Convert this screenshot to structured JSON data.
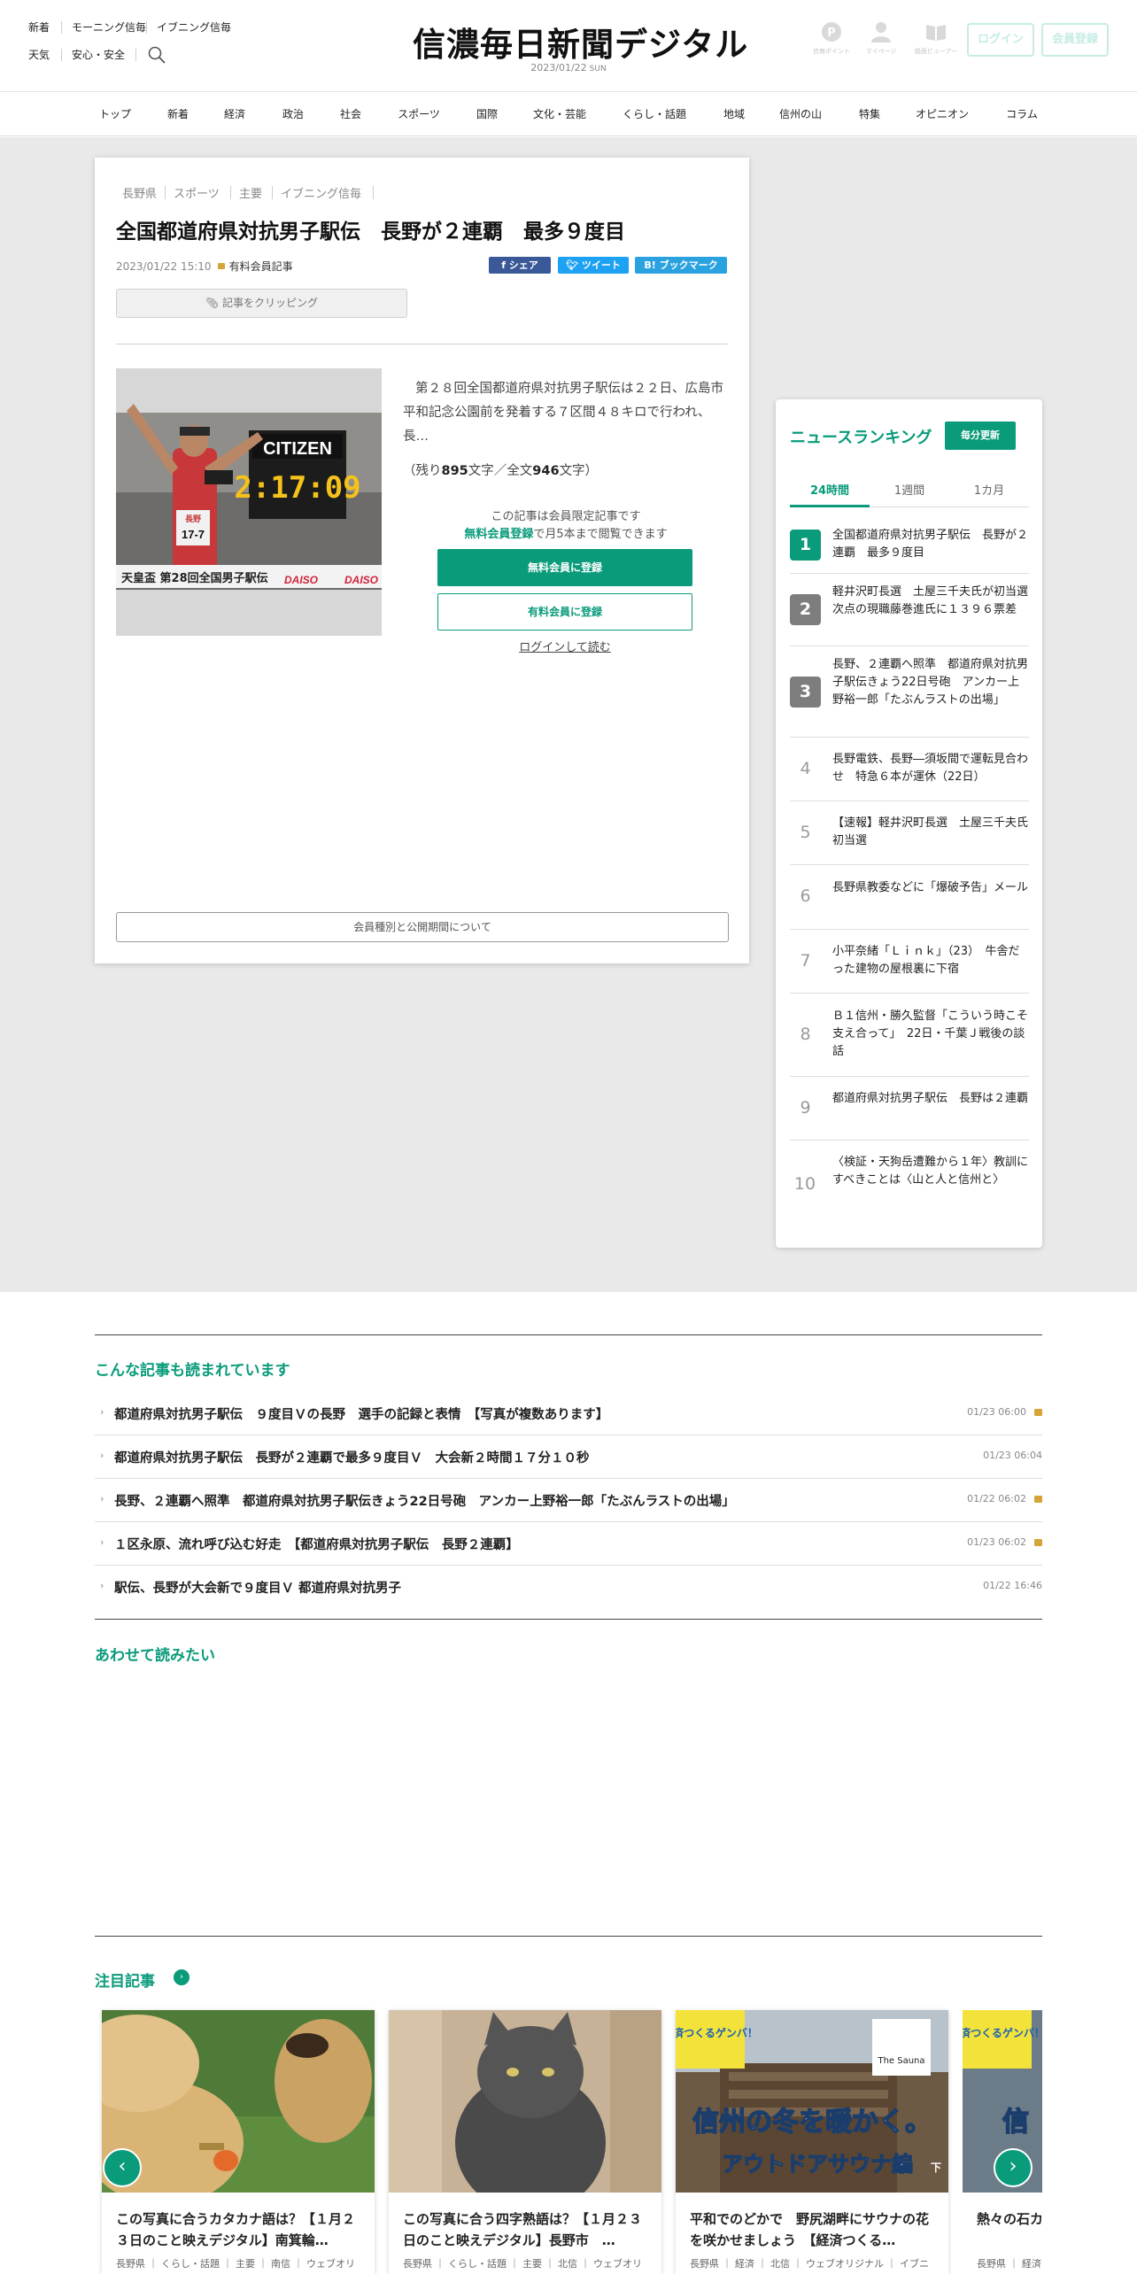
{
  "header": {
    "links_row1": [
      "新着",
      "モーニング信毎",
      "イブニング信毎"
    ],
    "links_row2": [
      "天気",
      "安心・安全"
    ],
    "logo": "信濃毎日新聞デジタル",
    "date": "2023/01/22",
    "weekday": "SUN",
    "icons": [
      {
        "icon": "point-icon",
        "label": "信毎ポイント"
      },
      {
        "icon": "user-icon",
        "label": "マイページ"
      },
      {
        "icon": "newspaper-viewer-icon",
        "label": "紙面ビューアー"
      }
    ],
    "login": "ログイン",
    "register": "会員登録"
  },
  "nav": [
    "トップ",
    "新着",
    "経済",
    "政治",
    "社会",
    "スポーツ",
    "国際",
    "文化・芸能",
    "くらし・話題",
    "地域",
    "信州の山",
    "特集",
    "オピニオン",
    "コラム"
  ],
  "article": {
    "tags": [
      "長野県",
      "スポーツ",
      "主要",
      "イブニング信毎"
    ],
    "title": "全国都道府県対抗男子駅伝　長野が２連覇　最多９度目",
    "datetime": "2023/01/22 15:10",
    "member_label": "有料会員記事",
    "share": {
      "facebook": "f シェア",
      "twitter": "ツイート",
      "hatena": "B! ブックマーク"
    },
    "clip": "記事をクリッピング",
    "lead": "第２８回全国都道府県対抗男子駅伝は２２日、広島市平和記念公園前を発着する７区間４８キロで行われ、長…",
    "count_prefix": "（残り",
    "count_remaining": "895",
    "count_mid": "文字／全文",
    "count_total": "946",
    "count_suffix": "文字）",
    "members_only": "この記事は会員限定記事です",
    "free_register_link": "無料会員登録",
    "free_register_rest": "で月5本まで閲覧できます",
    "btn_free": "無料会員に登録",
    "btn_paid": "有料会員に登録",
    "login_read": "ログインして読む",
    "member_types": "会員種別と公開期間について",
    "photo": {
      "sign": "CITIZEN",
      "clock": "2:17:09",
      "bib_pref": "長野",
      "bib": "17-7",
      "banner": "天皇盃 第28回全国男子駅伝",
      "sponsor": "DAISO"
    }
  },
  "ranking": {
    "title": "ニュースランキング",
    "update": "毎分更新",
    "tabs": [
      "24時間",
      "1週間",
      "1カ月"
    ],
    "items": [
      {
        "rank": "1",
        "text": "全国都道府県対抗男子駅伝　長野が２連覇　最多９度目"
      },
      {
        "rank": "2",
        "text": "軽井沢町長選　土屋三千夫氏が初当選　次点の現職藤巻進氏に１３９６票差"
      },
      {
        "rank": "3",
        "text": "長野、２連覇へ照準　都道府県対抗男子駅伝きょう22日号砲　アンカー上野裕一郎「たぶんラストの出場」"
      },
      {
        "rank": "4",
        "text": "長野電鉄、長野―須坂間で運転見合わせ　特急６本が運休（22日）"
      },
      {
        "rank": "5",
        "text": "【速報】軽井沢町長選　土屋三千夫氏初当選"
      },
      {
        "rank": "6",
        "text": "長野県教委などに「爆破予告」メール"
      },
      {
        "rank": "7",
        "text": "小平奈緒「Ｌｉｎｋ」（23）　牛舎だった建物の屋根裏に下宿"
      },
      {
        "rank": "8",
        "text": "Ｂ１信州・勝久監督「こういう時こそ支え合って」　22日・千葉Ｊ戦後の談話"
      },
      {
        "rank": "9",
        "text": "都道府県対抗男子駅伝　長野は２連覇"
      },
      {
        "rank": "10",
        "text": "〈検証・天狗岳遭難から１年〉教訓にすべきことは〈山と人と信州と〉"
      }
    ],
    "colors": {
      "r1": "#0a9b7b",
      "r2": "#7d7d7d",
      "r3": "#7d7d7d"
    }
  },
  "popular": {
    "title": "こんな記事も読まれています",
    "items": [
      {
        "text": "都道府県対抗男子駅伝　９度目Ｖの長野　選手の記録と表情　【写真が複数あります】",
        "date": "01/23 06:00",
        "locked": true
      },
      {
        "text": "都道府県対抗男子駅伝　長野が２連覇で最多９度目Ｖ　大会新２時間１７分１０秒",
        "date": "01/23 06:04",
        "locked": false
      },
      {
        "text": "長野、２連覇へ照準　都道府県対抗男子駅伝きょう22日号砲　アンカー上野裕一郎「たぶんラストの出場」",
        "date": "01/22 06:02",
        "locked": true
      },
      {
        "text": "１区永原、流れ呼び込む好走　【都道府県対抗男子駅伝　長野２連覇】",
        "date": "01/23 06:02",
        "locked": true
      },
      {
        "text": "駅伝、長野が大会新で９度目Ｖ 都道府県対抗男子",
        "date": "01/22 16:46",
        "locked": false
      }
    ]
  },
  "together": {
    "title": "あわせて読みたい"
  },
  "featured": {
    "title": "注目記事",
    "cards": [
      {
        "title": "この写真に合うカタカナ語は？【１月２３日のこと映えデジタル】南箕輪…",
        "tags": "長野県 ｜ くらし・話題 ｜ 主要 ｜ 南信 ｜ ウェブオリ"
      },
      {
        "title": "この写真に合う四字熟語は？【１月２３日のこと映えデジタル】長野市　…",
        "tags": "長野県 ｜ くらし・話題 ｜ 主要 ｜ 北信 ｜ ウェブオリ"
      },
      {
        "title": "平和でのどかで　野尻湖畔にサウナの花を咲かせましょう　【経済つくる…",
        "tags": "長野県 ｜ 経済 ｜ 北信 ｜ ウェブオリジナル ｜ イブニ",
        "badge": "経済つくるゲンバ！",
        "overlay": "信州の冬を暖かく。",
        "overlay2": "アウトドアサウナ編",
        "overlay2_suffix": "下",
        "sauna_logo": "The Sauna"
      },
      {
        "title": "熱々の石カ…「フィンラ",
        "tags": "長野県 ｜ 経済",
        "badge": "経済つくるゲンバ！",
        "overlay": "信"
      }
    ],
    "prev": "‹",
    "next": "›"
  }
}
